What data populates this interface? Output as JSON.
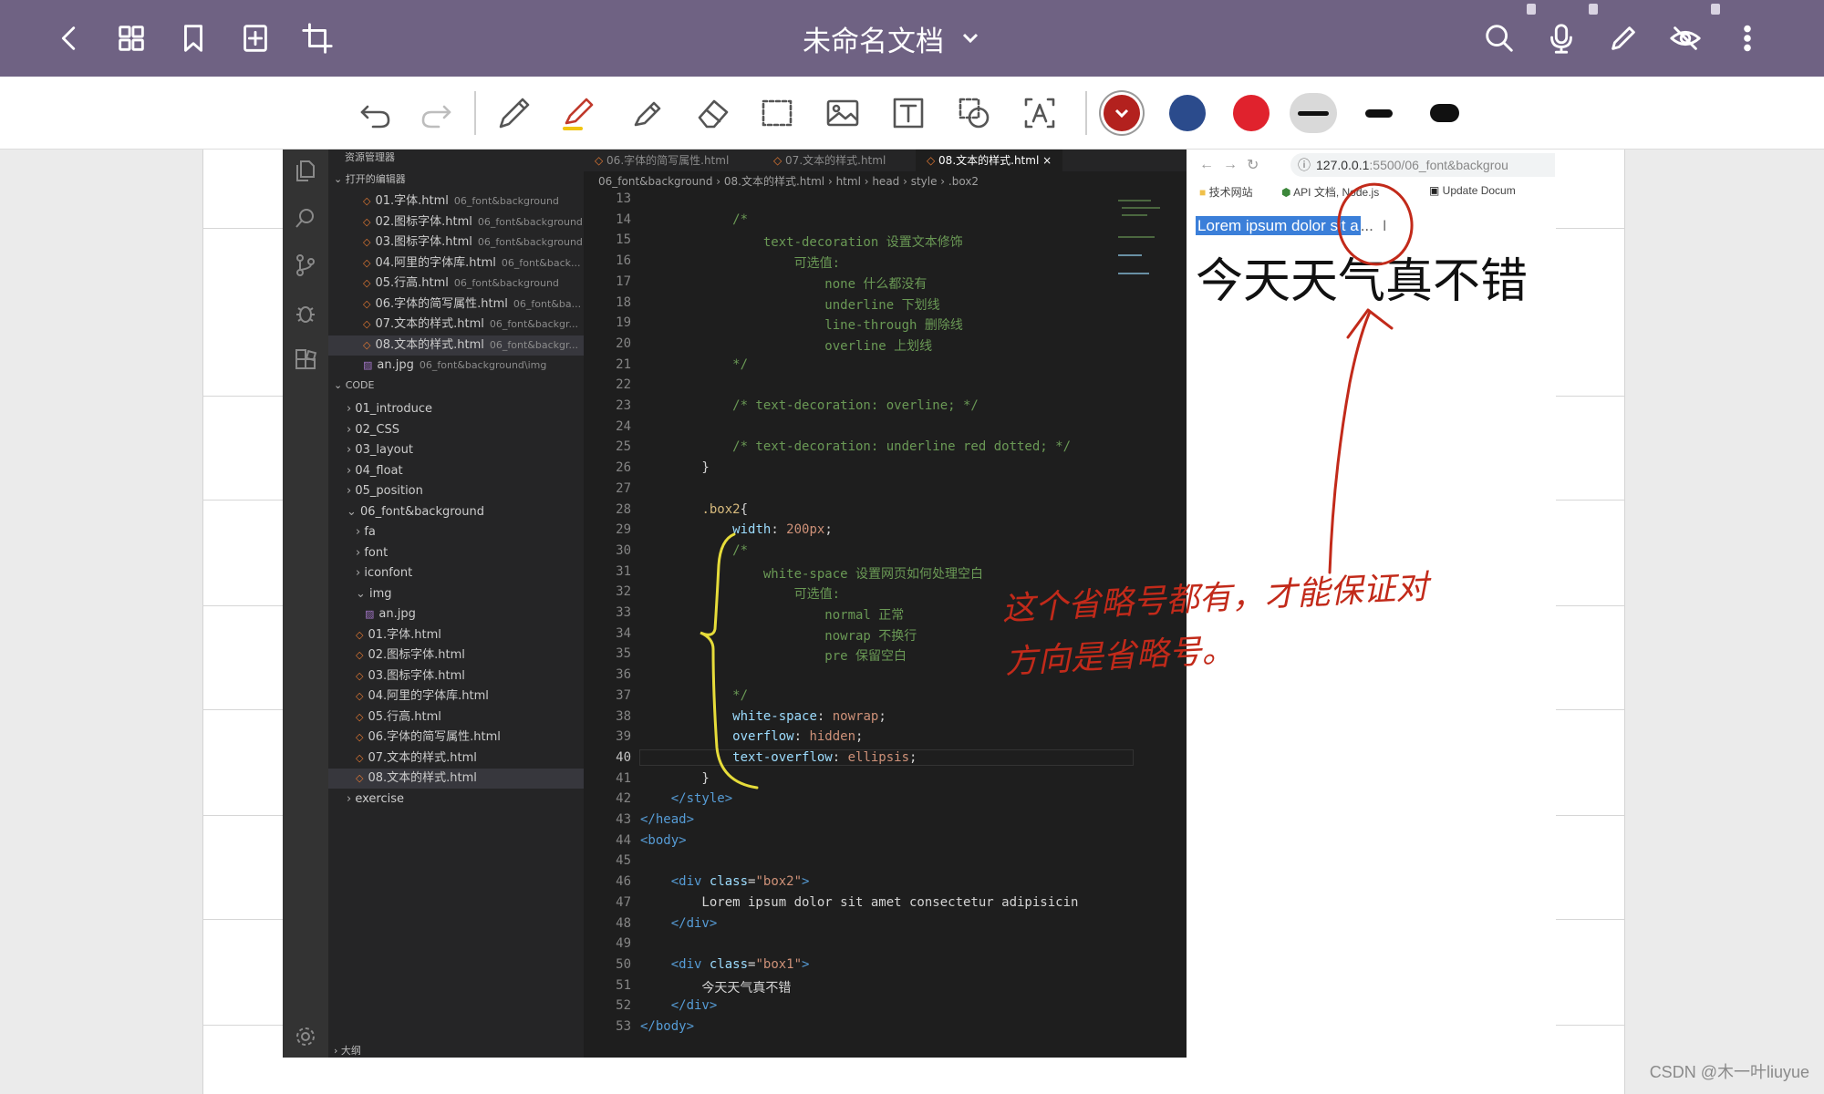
{
  "topbar": {
    "doc_title": "未命名文档"
  },
  "toolbar": {
    "colors": {
      "dark_red": "#b3211e",
      "navy": "#2b4b8c",
      "red": "#e0222d"
    },
    "icons": [
      "undo-icon",
      "redo-icon",
      "pen-icon",
      "highlighter-icon",
      "marker-icon",
      "eraser-icon",
      "lasso-select-icon",
      "image-icon",
      "text-box-icon",
      "shape-icon",
      "text-recognize-icon"
    ]
  },
  "vscode": {
    "explorer": {
      "header": "资源管理器",
      "open_editors_label": "打开的编辑器",
      "open_editors": [
        {
          "name": "01.字体.html",
          "path": "06_font&background"
        },
        {
          "name": "02.图标字体.html",
          "path": "06_font&background"
        },
        {
          "name": "03.图标字体.html",
          "path": "06_font&background"
        },
        {
          "name": "04.阿里的字体库.html",
          "path": "06_font&back..."
        },
        {
          "name": "05.行高.html",
          "path": "06_font&background"
        },
        {
          "name": "06.字体的简写属性.html",
          "path": "06_font&ba..."
        },
        {
          "name": "07.文本的样式.html",
          "path": "06_font&backgr..."
        },
        {
          "name": "08.文本的样式.html",
          "path": "06_font&backgr..."
        },
        {
          "name": "an.jpg",
          "path": "06_font&background\\img"
        }
      ],
      "workspace_label": "CODE",
      "tree": [
        {
          "name": "01_introduce",
          "indent": 0,
          "type": "folder"
        },
        {
          "name": "02_CSS",
          "indent": 0,
          "type": "folder"
        },
        {
          "name": "03_layout",
          "indent": 0,
          "type": "folder"
        },
        {
          "name": "04_float",
          "indent": 0,
          "type": "folder"
        },
        {
          "name": "05_position",
          "indent": 0,
          "type": "folder"
        },
        {
          "name": "06_font&background",
          "indent": 0,
          "type": "folder-open"
        },
        {
          "name": "fa",
          "indent": 1,
          "type": "folder"
        },
        {
          "name": "font",
          "indent": 1,
          "type": "folder"
        },
        {
          "name": "iconfont",
          "indent": 1,
          "type": "folder"
        },
        {
          "name": "img",
          "indent": 1,
          "type": "folder-open"
        },
        {
          "name": "an.jpg",
          "indent": 2,
          "type": "image"
        },
        {
          "name": "01.字体.html",
          "indent": 1,
          "type": "html"
        },
        {
          "name": "02.图标字体.html",
          "indent": 1,
          "type": "html"
        },
        {
          "name": "03.图标字体.html",
          "indent": 1,
          "type": "html"
        },
        {
          "name": "04.阿里的字体库.html",
          "indent": 1,
          "type": "html"
        },
        {
          "name": "05.行高.html",
          "indent": 1,
          "type": "html"
        },
        {
          "name": "06.字体的简写属性.html",
          "indent": 1,
          "type": "html"
        },
        {
          "name": "07.文本的样式.html",
          "indent": 1,
          "type": "html"
        },
        {
          "name": "08.文本的样式.html",
          "indent": 1,
          "type": "html"
        },
        {
          "name": "exercise",
          "indent": 0,
          "type": "folder"
        }
      ],
      "outline_label": "大纲"
    },
    "tabs": [
      "06.字体的简写属性.html",
      "07.文本的样式.html",
      "08.文本的样式.html"
    ],
    "breadcrumb": "06_font&background › 08.文本的样式.html › html › head › style › .box2",
    "current_line": 40,
    "lines": [
      {
        "n": 13,
        "t": ""
      },
      {
        "n": 14,
        "t": "            /*"
      },
      {
        "n": 15,
        "t": "                text-decoration 设置文本修饰"
      },
      {
        "n": 16,
        "t": "                    可选值:"
      },
      {
        "n": 17,
        "t": "                        none 什么都没有"
      },
      {
        "n": 18,
        "t": "                        underline 下划线"
      },
      {
        "n": 19,
        "t": "                        line-through 删除线"
      },
      {
        "n": 20,
        "t": "                        overline 上划线"
      },
      {
        "n": 21,
        "t": "            */"
      },
      {
        "n": 22,
        "t": ""
      },
      {
        "n": 23,
        "t": "            /* text-decoration: overline; */"
      },
      {
        "n": 24,
        "t": ""
      },
      {
        "n": 25,
        "t": "            /* text-decoration: underline red dotted; */"
      },
      {
        "n": 26,
        "t": "        }"
      },
      {
        "n": 27,
        "t": ""
      },
      {
        "n": 28,
        "t": "        .box2{"
      },
      {
        "n": 29,
        "t": "            width: 200px;"
      },
      {
        "n": 30,
        "t": "            /*"
      },
      {
        "n": 31,
        "t": "                white-space 设置网页如何处理空白"
      },
      {
        "n": 32,
        "t": "                    可选值:"
      },
      {
        "n": 33,
        "t": "                        normal 正常"
      },
      {
        "n": 34,
        "t": "                        nowrap 不换行"
      },
      {
        "n": 35,
        "t": "                        pre 保留空白"
      },
      {
        "n": 36,
        "t": ""
      },
      {
        "n": 37,
        "t": "            */"
      },
      {
        "n": 38,
        "t": "            white-space: nowrap;"
      },
      {
        "n": 39,
        "t": "            overflow: hidden;"
      },
      {
        "n": 40,
        "t": "            text-overflow: ellipsis;"
      },
      {
        "n": 41,
        "t": "        }"
      },
      {
        "n": 42,
        "t": "    </style>"
      },
      {
        "n": 43,
        "t": "</head>"
      },
      {
        "n": 44,
        "t": "<body>"
      },
      {
        "n": 45,
        "t": ""
      },
      {
        "n": 46,
        "t": "    <div class=\"box2\">"
      },
      {
        "n": 47,
        "t": "        Lorem ipsum dolor sit amet consectetur adipisicin"
      },
      {
        "n": 48,
        "t": "    </div>"
      },
      {
        "n": 49,
        "t": ""
      },
      {
        "n": 50,
        "t": "    <div class=\"box1\">"
      },
      {
        "n": 51,
        "t": "        今天天气真不错"
      },
      {
        "n": 52,
        "t": "    </div>"
      },
      {
        "n": 53,
        "t": "</body>"
      }
    ]
  },
  "browser": {
    "url_host": "127.0.0.1",
    "url_path": ":5500/06_font&backgrou",
    "bookmarks": [
      "技术网站",
      "API 文档, Node.js",
      "Update Docum"
    ],
    "lorem_selected": "Lorem ipsum dolor sit a",
    "ellipsis": "...",
    "big_text": "今天天气真不错"
  },
  "annotation": {
    "line1": "这个省略号都有，才能保证对",
    "line2": "方向是省略号。",
    "ink_color": "#c22a1a"
  },
  "watermark": "CSDN @木一叶liuyue"
}
